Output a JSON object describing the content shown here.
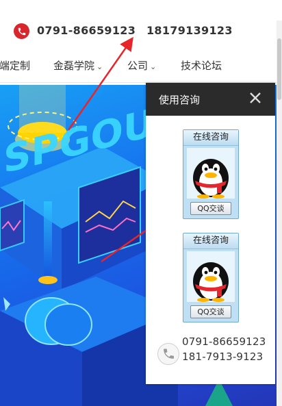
{
  "header": {
    "phone_1": "0791-86659123",
    "phone_2": "18179139123",
    "phone_icon": "phone-icon",
    "accent": "#d9262c"
  },
  "nav": {
    "items": [
      {
        "label": "端定制",
        "has_dropdown": false
      },
      {
        "label": "金磊学院",
        "has_dropdown": true
      },
      {
        "label": "公司",
        "has_dropdown": true
      },
      {
        "label": "技术论坛",
        "has_dropdown": false
      }
    ],
    "dropdown_glyph": "chevron-down-icon"
  },
  "banner": {
    "art_lettering": "SPGOU",
    "background": "#1671ef"
  },
  "consult_panel": {
    "title": "使用咨询",
    "close_icon": "close-icon",
    "header_color": "#2b2b2b",
    "cards": [
      {
        "caption": "在线咨询",
        "button": "QQ交谈"
      },
      {
        "caption": "在线咨询",
        "button": "QQ交谈"
      }
    ],
    "phones": [
      "0791-86659123",
      "181-7913-9123"
    ]
  },
  "annotation_arrows": {
    "color": "#e8242b",
    "count": 2
  }
}
